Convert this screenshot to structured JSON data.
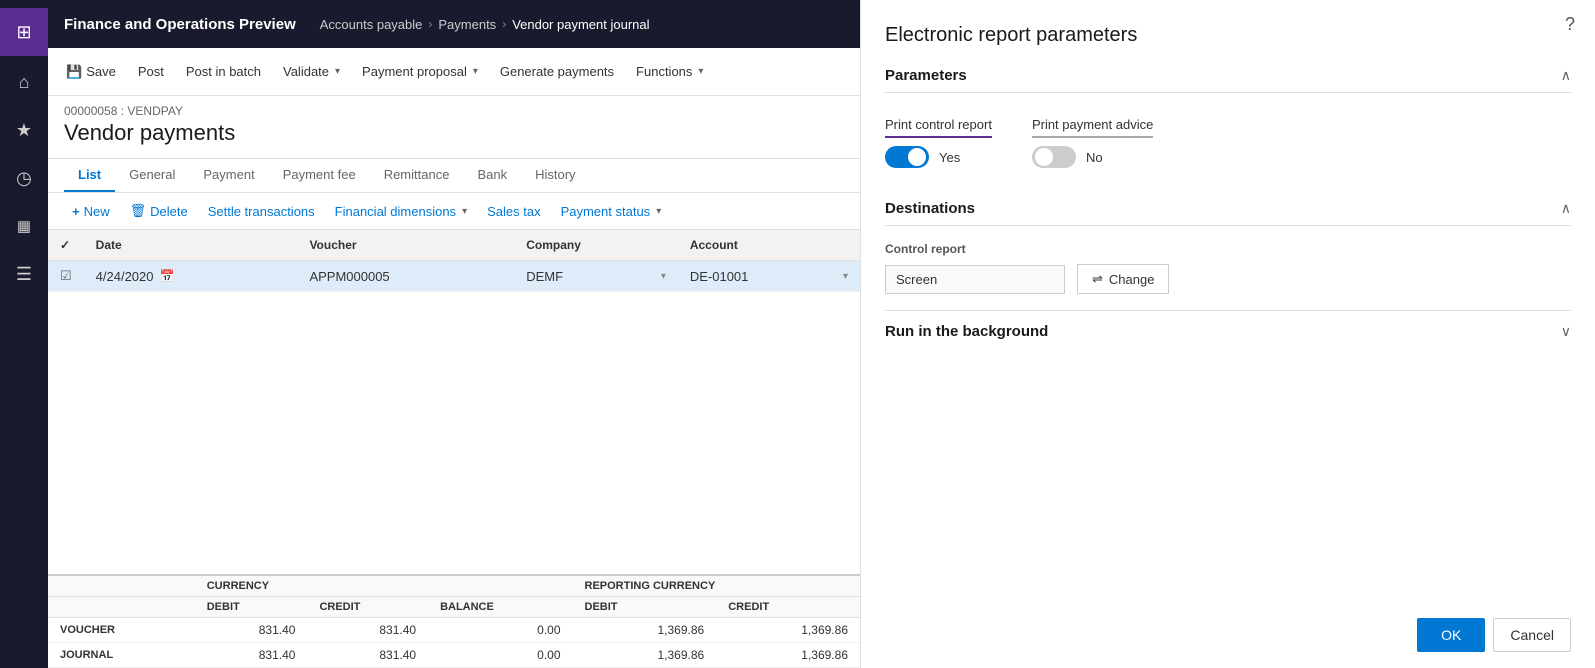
{
  "app": {
    "title": "Finance and Operations Preview",
    "sidebar_items": [
      {
        "icon": "⊞",
        "name": "grid-icon"
      },
      {
        "icon": "⌂",
        "name": "home-icon"
      },
      {
        "icon": "★",
        "name": "favorites-icon"
      },
      {
        "icon": "◷",
        "name": "recent-icon"
      },
      {
        "icon": "▦",
        "name": "modules-icon"
      },
      {
        "icon": "☰",
        "name": "workspaces-icon"
      }
    ]
  },
  "breadcrumb": {
    "items": [
      "Accounts payable",
      "Payments",
      "Vendor payment journal"
    ]
  },
  "toolbar": {
    "save_label": "Save",
    "post_label": "Post",
    "post_batch_label": "Post in batch",
    "validate_label": "Validate",
    "payment_proposal_label": "Payment proposal",
    "generate_payments_label": "Generate payments",
    "functions_label": "Functions",
    "more_label": "..."
  },
  "journal": {
    "id": "00000058 : VENDPAY",
    "title": "Vendor payments"
  },
  "tabs": [
    {
      "label": "List",
      "active": true
    },
    {
      "label": "General",
      "active": false
    },
    {
      "label": "Payment",
      "active": false
    },
    {
      "label": "Payment fee",
      "active": false
    },
    {
      "label": "Remittance",
      "active": false
    },
    {
      "label": "Bank",
      "active": false
    },
    {
      "label": "History",
      "active": false
    }
  ],
  "actions": [
    {
      "label": "New",
      "icon": "+"
    },
    {
      "label": "Delete",
      "icon": "🗑"
    },
    {
      "label": "Settle transactions",
      "icon": ""
    },
    {
      "label": "Financial dimensions",
      "icon": "",
      "dropdown": true
    },
    {
      "label": "Sales tax",
      "icon": ""
    },
    {
      "label": "Payment status",
      "icon": "",
      "dropdown": true
    }
  ],
  "table": {
    "columns": [
      "Date",
      "Voucher",
      "Company",
      "Account"
    ],
    "rows": [
      {
        "selected": true,
        "date": "4/24/2020",
        "voucher": "APPM000005",
        "company": "DEMF",
        "account": "DE-01001"
      }
    ]
  },
  "footer": {
    "currency_label": "CURRENCY",
    "reporting_currency_label": "REPORTING CURRENCY",
    "col_debit": "DEBIT",
    "col_credit": "CREDIT",
    "col_balance": "BALANCE",
    "rows": [
      {
        "label": "VOUCHER",
        "debit": "831.40",
        "credit": "831.40",
        "balance": "0.00",
        "rep_debit": "1,369.86",
        "rep_credit": "1,369.86"
      },
      {
        "label": "JOURNAL",
        "debit": "831.40",
        "credit": "831.40",
        "balance": "0.00",
        "rep_debit": "1,369.86",
        "rep_credit": "1,369.86"
      }
    ]
  },
  "right_panel": {
    "title": "Electronic report parameters",
    "parameters_section": {
      "label": "Parameters",
      "print_control_report": {
        "label": "Print control report",
        "value": "Yes",
        "toggled": true
      },
      "print_payment_advice": {
        "label": "Print payment advice",
        "value": "No",
        "toggled": false
      }
    },
    "destinations_section": {
      "label": "Destinations",
      "control_report_label": "Control report",
      "screen_value": "Screen",
      "change_btn_label": "Change",
      "change_icon": "⇌"
    },
    "run_background_section": {
      "label": "Run in the background"
    },
    "buttons": {
      "ok": "OK",
      "cancel": "Cancel"
    }
  }
}
